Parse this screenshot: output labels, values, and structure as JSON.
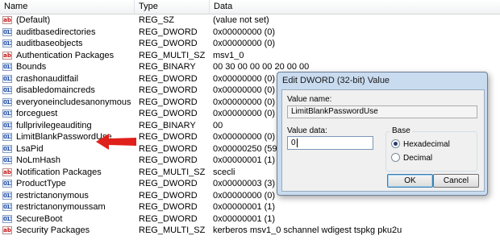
{
  "columns": {
    "name": "Name",
    "type": "Type",
    "data": "Data"
  },
  "rows": [
    {
      "icon": "string-value-icon",
      "icon_glyph": "ab",
      "name": "(Default)",
      "type": "REG_SZ",
      "data": "(value not set)"
    },
    {
      "icon": "binary-value-icon",
      "icon_glyph": "011",
      "name": "auditbasedirectories",
      "type": "REG_DWORD",
      "data": "0x00000000 (0)"
    },
    {
      "icon": "binary-value-icon",
      "icon_glyph": "011",
      "name": "auditbaseobjects",
      "type": "REG_DWORD",
      "data": "0x00000000 (0)"
    },
    {
      "icon": "string-value-icon",
      "icon_glyph": "ab",
      "name": "Authentication Packages",
      "type": "REG_MULTI_SZ",
      "data": "msv1_0"
    },
    {
      "icon": "binary-value-icon",
      "icon_glyph": "011",
      "name": "Bounds",
      "type": "REG_BINARY",
      "data": "00 30 00 00 00 20 00 00"
    },
    {
      "icon": "binary-value-icon",
      "icon_glyph": "011",
      "name": "crashonauditfail",
      "type": "REG_DWORD",
      "data": "0x00000000 (0)"
    },
    {
      "icon": "binary-value-icon",
      "icon_glyph": "011",
      "name": "disabledomaincreds",
      "type": "REG_DWORD",
      "data": "0x00000000 (0)"
    },
    {
      "icon": "binary-value-icon",
      "icon_glyph": "011",
      "name": "everyoneincludesanonymous",
      "type": "REG_DWORD",
      "data": "0x00000000 (0)"
    },
    {
      "icon": "binary-value-icon",
      "icon_glyph": "011",
      "name": "forceguest",
      "type": "REG_DWORD",
      "data": "0x00000000 (0)"
    },
    {
      "icon": "binary-value-icon",
      "icon_glyph": "011",
      "name": "fullprivilegeauditing",
      "type": "REG_BINARY",
      "data": "00"
    },
    {
      "icon": "binary-value-icon",
      "icon_glyph": "011",
      "name": "LimitBlankPasswordUse",
      "type": "REG_DWORD",
      "data": "0x00000000 (0)"
    },
    {
      "icon": "binary-value-icon",
      "icon_glyph": "011",
      "name": "LsaPid",
      "type": "REG_DWORD",
      "data": "0x00000250 (592)"
    },
    {
      "icon": "binary-value-icon",
      "icon_glyph": "011",
      "name": "NoLmHash",
      "type": "REG_DWORD",
      "data": "0x00000001 (1)"
    },
    {
      "icon": "string-value-icon",
      "icon_glyph": "ab",
      "name": "Notification Packages",
      "type": "REG_MULTI_SZ",
      "data": "scecli"
    },
    {
      "icon": "binary-value-icon",
      "icon_glyph": "011",
      "name": "ProductType",
      "type": "REG_DWORD",
      "data": "0x00000003 (3)"
    },
    {
      "icon": "binary-value-icon",
      "icon_glyph": "011",
      "name": "restrictanonymous",
      "type": "REG_DWORD",
      "data": "0x00000000 (0)"
    },
    {
      "icon": "binary-value-icon",
      "icon_glyph": "011",
      "name": "restrictanonymoussam",
      "type": "REG_DWORD",
      "data": "0x00000001 (1)"
    },
    {
      "icon": "binary-value-icon",
      "icon_glyph": "011",
      "name": "SecureBoot",
      "type": "REG_DWORD",
      "data": "0x00000001 (1)"
    },
    {
      "icon": "string-value-icon",
      "icon_glyph": "ab",
      "name": "Security Packages",
      "type": "REG_MULTI_SZ",
      "data": "kerberos msv1_0 schannel wdigest tspkg pku2u"
    }
  ],
  "annotation": {
    "arrow_color": "#e0201b"
  },
  "dialog": {
    "title": "Edit DWORD (32-bit) Value",
    "value_name_label": "Value name:",
    "value_name": "LimitBlankPasswordUse",
    "value_data_label": "Value data:",
    "value_data": "0",
    "base_label": "Base",
    "base_options": [
      "Hexadecimal",
      "Decimal"
    ],
    "base_selected": "Hexadecimal",
    "ok_label": "OK",
    "cancel_label": "Cancel"
  }
}
